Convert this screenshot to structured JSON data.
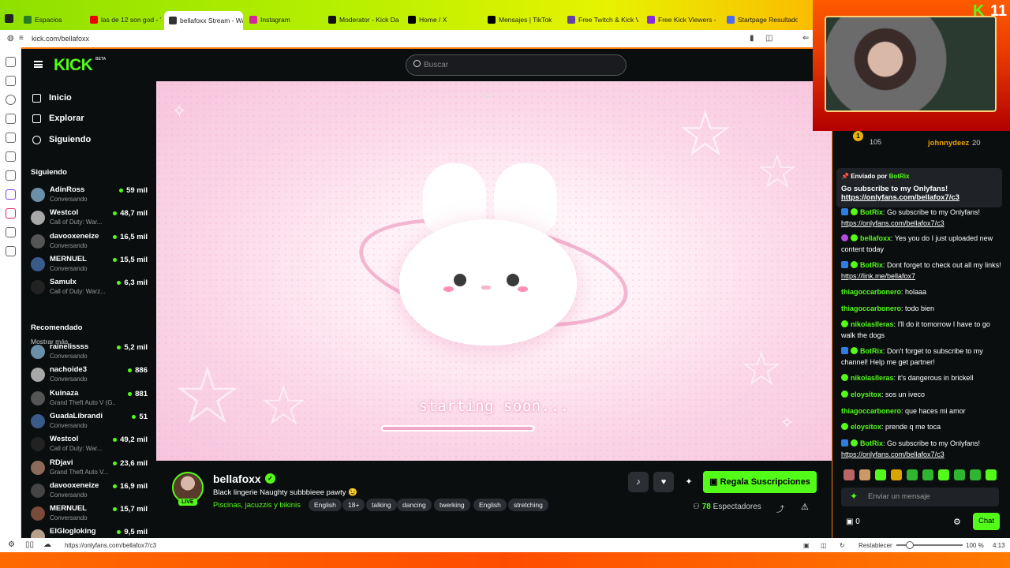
{
  "browser": {
    "tabs": [
      "Espacios",
      "las de 12 son god - Y",
      "bellafoxx Stream - Wa",
      "Instagram",
      "Moderator - Kick Das",
      "Home / X",
      "Mensajes | TikTok",
      "Free Twitch & Kick Vi",
      "Free Kick Viewers - B",
      "Startpage Resultados"
    ],
    "url": "kick.com/bellafoxx",
    "status_url": "https://onlyfans.com/bellafox7/c3",
    "restore_label": "Restablecer",
    "zoom": "100 %",
    "zoom_fraction": 0.14,
    "time": "4:13"
  },
  "kick": {
    "logo": "KICK",
    "beta": "BETA",
    "search_placeholder": "Buscar",
    "nav": [
      "Inicio",
      "Explorar",
      "Siguiendo"
    ],
    "following_title": "Siguiendo",
    "following": [
      {
        "name": "AdinRoss",
        "sub": "Conversando",
        "viewers": "59 mil"
      },
      {
        "name": "Westcol",
        "sub": "Call of Duty: War...",
        "viewers": "48,7 mil"
      },
      {
        "name": "davooxeneize",
        "sub": "Conversando",
        "viewers": "16,5 mil"
      },
      {
        "name": "MERNUEL",
        "sub": "Conversando",
        "viewers": "15,5 mil"
      },
      {
        "name": "Samulx",
        "sub": "Call of Duty: Warz...",
        "viewers": "6,3 mil"
      }
    ],
    "show_more": "Mostrar más",
    "recommended_title": "Recomendado",
    "recommended": [
      {
        "name": "rainelissss",
        "sub": "Conversando",
        "viewers": "5,2 mil"
      },
      {
        "name": "nachoide3",
        "sub": "Conversando",
        "viewers": "886"
      },
      {
        "name": "Kuinaza",
        "sub": "Grand Theft Auto V (G...",
        "viewers": "881"
      },
      {
        "name": "GuadaLibrandi",
        "sub": "Conversando",
        "viewers": "51"
      },
      {
        "name": "Westcol",
        "sub": "Call of Duty: War...",
        "viewers": "49,2 mil"
      },
      {
        "name": "RDjavi",
        "sub": "Grand Theft Auto V...",
        "viewers": "23,6 mil"
      },
      {
        "name": "davooxeneize",
        "sub": "Conversando",
        "viewers": "16,9 mil"
      },
      {
        "name": "MERNUEL",
        "sub": "Conversando",
        "viewers": "15,7 mil"
      },
      {
        "name": "ElGlogloking",
        "sub": "",
        "viewers": "9,5 mil"
      }
    ],
    "player": {
      "overlay_text": "starting soon...",
      "progress_fraction": 0.99
    },
    "stream": {
      "name": "bellafoxx",
      "live": "LIVE",
      "title": "Black lingerie Naughty subbbieee pawty 😉",
      "category": "Piscinas, jacuzzis y bikinis",
      "tags": [
        "English",
        "18+",
        "talking",
        "dancing",
        "twerking",
        "English",
        "stretching"
      ],
      "gift_label": "Regala Suscripciones",
      "viewers_count": "78",
      "viewers_label": "Espectadores"
    }
  },
  "webcam": {
    "badge_k": "K",
    "badge_num": "11"
  },
  "chat": {
    "leaderboard": [
      {
        "rank": "1",
        "count": "105"
      },
      {
        "name": "johnnydeez",
        "count": "20"
      }
    ],
    "pinned": {
      "header": "Enviado por",
      "user": "BotRix",
      "text": "Go subscribe to my Onlyfans!",
      "link": "https://onlyfans.com/bellafox7/c3"
    },
    "messages": [
      {
        "user": "BotRix",
        "text": "Go subscribe to my Onlyfans!",
        "link": "https://onlyfans.com/bellafox7/c3",
        "color": "#53fc18"
      },
      {
        "user": "bellafoxx",
        "text": "Yes you do I just uploaded new content today",
        "link": "",
        "color": "#53fc18"
      },
      {
        "user": "BotRix",
        "text": "Dont forget to check out all my links!",
        "link": "https://link.me/bellafox7",
        "color": "#53fc18"
      },
      {
        "user": "thiagoccarbonero",
        "text": "holaaa",
        "link": "",
        "color": "#53fc18"
      },
      {
        "user": "thiagoccarbonero",
        "text": "todo bien",
        "link": "",
        "color": "#53fc18"
      },
      {
        "user": "nikolaslleras",
        "text": "I'll do it tomorrow I have to go walk the dogs",
        "link": "",
        "color": "#53fc18"
      },
      {
        "user": "BotRix",
        "text": "Don't forget to subscribe to my channel! Help me get partner!",
        "link": "",
        "color": "#53fc18"
      },
      {
        "user": "nikolaslleras",
        "text": "it's dangerous in brickell",
        "link": "",
        "color": "#53fc18"
      },
      {
        "user": "eloysitox",
        "text": "sos un iveco",
        "link": "",
        "color": "#53fc18"
      },
      {
        "user": "thiagoccarbonero",
        "text": "que haces mi amor",
        "link": "",
        "color": "#53fc18"
      },
      {
        "user": "eloysitox",
        "text": "prende q me toca",
        "link": "",
        "color": "#53fc18"
      },
      {
        "user": "BotRix",
        "text": "Go subscribe to my Onlyfans!",
        "link": "https://onlyfans.com/bellafox7/c3",
        "color": "#53fc18"
      }
    ],
    "input_placeholder": "Enviar un mensaje",
    "gift_count": "0",
    "send_label": "Chat"
  }
}
